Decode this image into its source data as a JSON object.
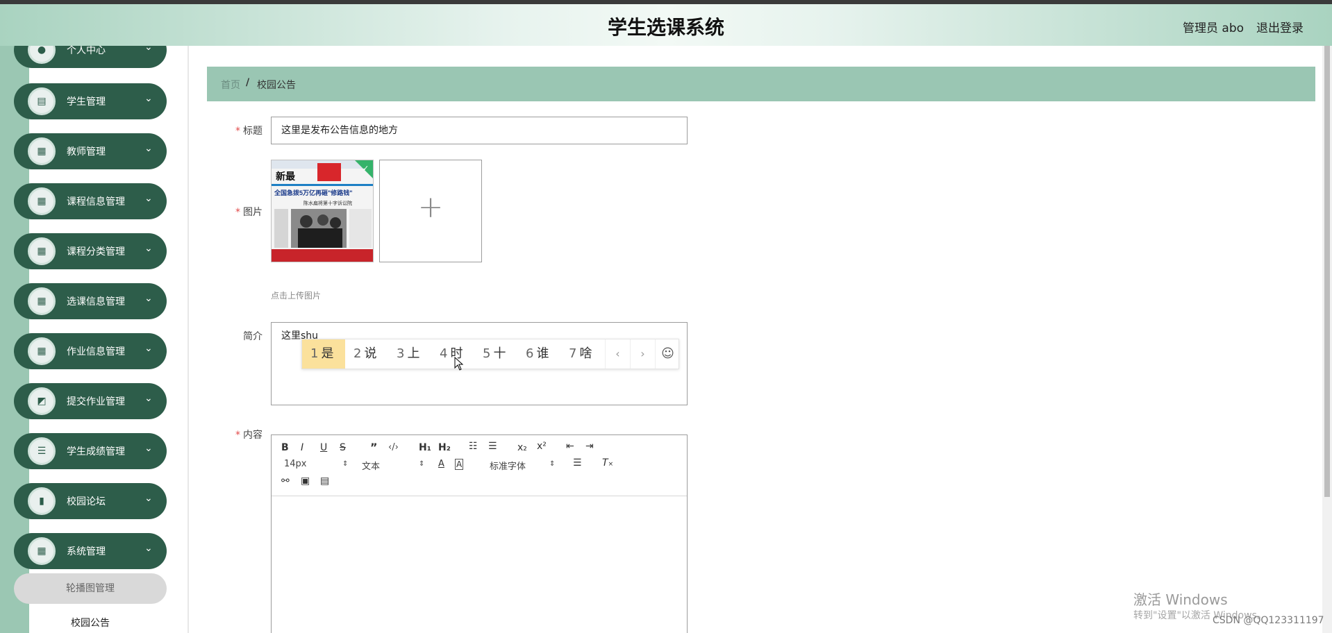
{
  "header": {
    "title": "学生选课系统",
    "user": "管理员 abo",
    "logout": "退出登录"
  },
  "sidebar": {
    "items": [
      {
        "label": "个人中心",
        "icon": "person-icon",
        "glyph": "●"
      },
      {
        "label": "学生管理",
        "icon": "clipboard-icon",
        "glyph": "▤"
      },
      {
        "label": "教师管理",
        "icon": "grid-icon",
        "glyph": "▦"
      },
      {
        "label": "课程信息管理",
        "icon": "grid-icon",
        "glyph": "▦"
      },
      {
        "label": "课程分类管理",
        "icon": "grid-icon",
        "glyph": "▦"
      },
      {
        "label": "选课信息管理",
        "icon": "grid-icon",
        "glyph": "▦"
      },
      {
        "label": "作业信息管理",
        "icon": "grid-icon",
        "glyph": "▦"
      },
      {
        "label": "提交作业管理",
        "icon": "chart-line-icon",
        "glyph": "◩"
      },
      {
        "label": "学生成绩管理",
        "icon": "list-icon",
        "glyph": "☰"
      },
      {
        "label": "校园论坛",
        "icon": "bar-chart-icon",
        "glyph": "▮"
      },
      {
        "label": "系统管理",
        "icon": "grid-icon",
        "glyph": "▦"
      }
    ],
    "sub_items": [
      "轮播图管理",
      "校园公告"
    ],
    "chevron": "⌄"
  },
  "breadcrumb": {
    "home": "首页",
    "separator": "/",
    "current": "校园公告"
  },
  "form": {
    "title_label": "标题",
    "title_value": "这里是发布公告信息的地方",
    "image_label": "图片",
    "upload_plus": "+",
    "upload_tip": "点击上传图片",
    "intro_label": "简介",
    "intro_value": "这里shu",
    "content_label": "内容",
    "required_mark": "*"
  },
  "ime": {
    "candidates": [
      {
        "n": "1",
        "w": "是"
      },
      {
        "n": "2",
        "w": "说"
      },
      {
        "n": "3",
        "w": "上"
      },
      {
        "n": "4",
        "w": "时"
      },
      {
        "n": "5",
        "w": "十"
      },
      {
        "n": "6",
        "w": "谁"
      },
      {
        "n": "7",
        "w": "啥"
      }
    ],
    "prev": "‹",
    "next": "›",
    "smile": "☺"
  },
  "editor": {
    "font_size": "14px",
    "text_type": "文本",
    "font_family": "标准字体"
  },
  "thumbnail": {
    "headline": "全国急拨5万亿再砸\"修路钱\"",
    "masthead": "新最",
    "subhead": "陈水扁将第十字诉讼院"
  },
  "watermark": {
    "line1": "激活 Windows",
    "line2": "转到\"设置\"以激活 Windows。",
    "csdn": "CSDN @QQ123311197"
  },
  "colors": {
    "menu_bg": "#2d5d4a",
    "rail": "#9bc7b3",
    "breadcrumb_bg": "#9ac6b3",
    "required": "#e24a4a",
    "ime_highlight": "#fbe19c"
  }
}
